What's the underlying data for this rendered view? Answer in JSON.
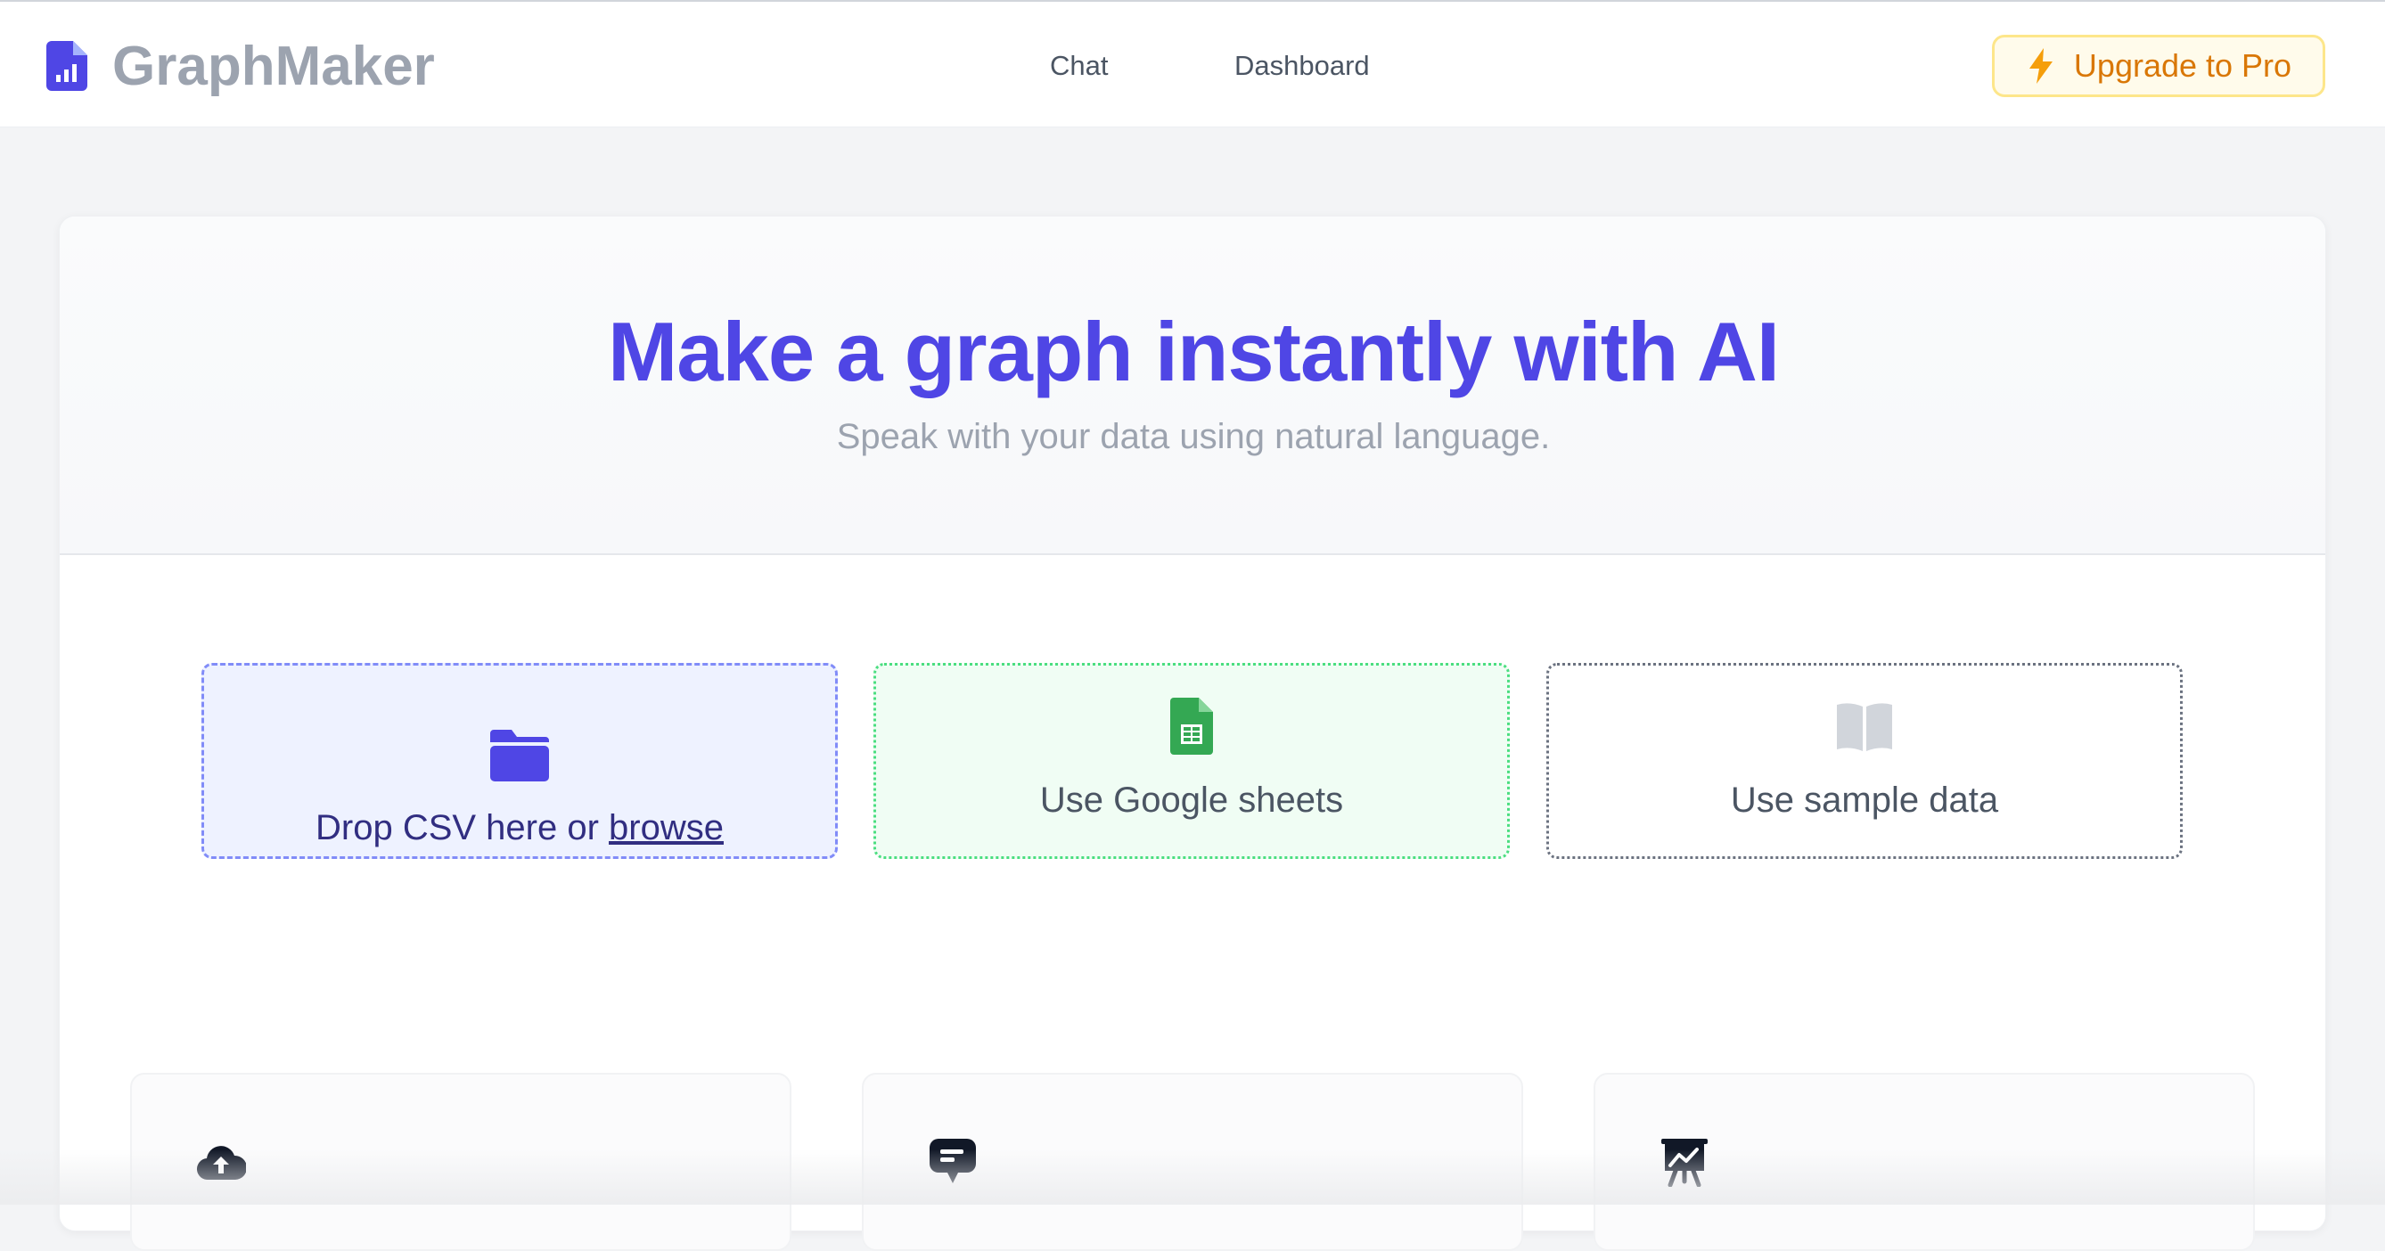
{
  "app": {
    "name": "GraphMaker",
    "logo_icon": "file-chart-icon",
    "accent_color": "#4f46e5"
  },
  "nav": {
    "items": [
      {
        "label": "Chat"
      },
      {
        "label": "Dashboard"
      }
    ]
  },
  "upgrade": {
    "label": "Upgrade to Pro",
    "icon": "lightning-bolt-icon",
    "color": "#d97706"
  },
  "hero": {
    "title": "Make a graph instantly with AI",
    "subtitle": "Speak with your data using natural language."
  },
  "options": {
    "csv": {
      "prefix": "Drop CSV here or ",
      "link": "browse",
      "icon": "folder-icon"
    },
    "google_sheets": {
      "label": "Use Google sheets",
      "icon": "google-sheets-icon"
    },
    "sample": {
      "label": "Use sample data",
      "icon": "open-book-icon"
    }
  },
  "features": [
    {
      "icon": "cloud-upload-icon"
    },
    {
      "icon": "chat-message-icon"
    },
    {
      "icon": "presentation-chart-icon"
    }
  ]
}
